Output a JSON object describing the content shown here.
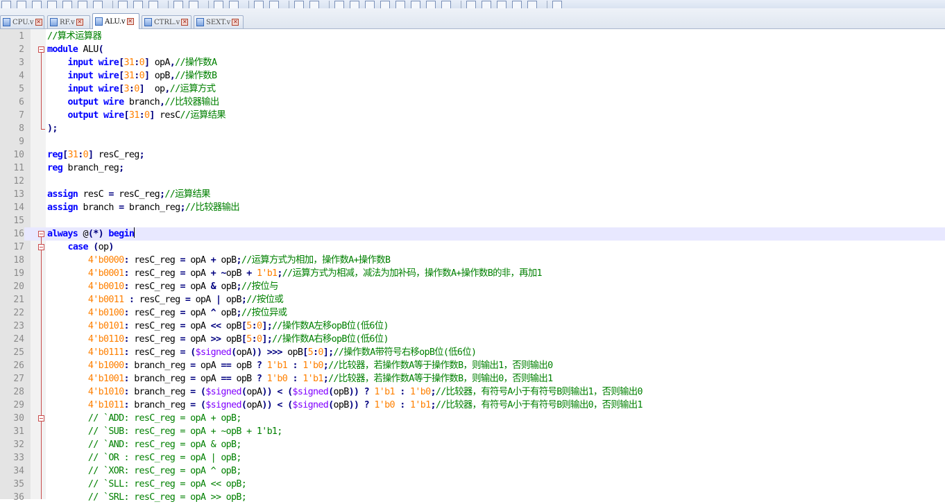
{
  "toolbar": {
    "icons": [
      "new-file-icon",
      "open-file-icon",
      "save-icon",
      "save-all-icon",
      "close-icon",
      "close-all-icon",
      "print-icon",
      "separator",
      "cut-icon",
      "copy-icon",
      "paste-icon",
      "separator",
      "undo-icon",
      "redo-icon",
      "separator",
      "find-icon",
      "replace-icon",
      "separator",
      "zoom-in-icon",
      "zoom-out-icon",
      "separator",
      "sync-v-icon",
      "sync-h-icon",
      "separator",
      "word-wrap-icon",
      "all-chars-icon",
      "indent-guide-icon",
      "user-lang-icon",
      "doc-map-icon",
      "function-list-icon",
      "folder-workspace-icon",
      "monitor-icon",
      "separator",
      "record-macro-icon",
      "stop-macro-icon",
      "play-macro-icon",
      "run-macro-icon",
      "save-macro-icon",
      "separator",
      "spellcheck-icon"
    ]
  },
  "tabs": [
    {
      "label": "CPU.v",
      "active": false
    },
    {
      "label": "RF.v",
      "active": false
    },
    {
      "label": "ALU.v",
      "active": true
    },
    {
      "label": "CTRL.v",
      "active": false
    },
    {
      "label": "SEXT.v",
      "active": false
    }
  ],
  "colors": {
    "comment": "#008000",
    "keyword": "#0000ff",
    "number": "#ff8000",
    "operator": "#000080",
    "system_task": "#8000ff",
    "current_line": "#e8e8ff"
  },
  "current_line": 16,
  "lines": [
    {
      "n": "1",
      "t": [
        [
          "cm",
          "//算术运算器"
        ]
      ]
    },
    {
      "n": "2",
      "t": [
        [
          "kw",
          "module"
        ],
        [
          "id",
          " ALU"
        ],
        [
          "op",
          "("
        ]
      ]
    },
    {
      "n": "3",
      "t": [
        [
          "id",
          "    "
        ],
        [
          "kw",
          "input"
        ],
        [
          "id",
          " "
        ],
        [
          "kw",
          "wire"
        ],
        [
          "op",
          "["
        ],
        [
          "num",
          "31"
        ],
        [
          "op",
          ":"
        ],
        [
          "num",
          "0"
        ],
        [
          "op",
          "]"
        ],
        [
          "id",
          " opA"
        ],
        [
          "op",
          ","
        ],
        [
          "cm",
          "//操作数A"
        ]
      ]
    },
    {
      "n": "4",
      "t": [
        [
          "id",
          "    "
        ],
        [
          "kw",
          "input"
        ],
        [
          "id",
          " "
        ],
        [
          "kw",
          "wire"
        ],
        [
          "op",
          "["
        ],
        [
          "num",
          "31"
        ],
        [
          "op",
          ":"
        ],
        [
          "num",
          "0"
        ],
        [
          "op",
          "]"
        ],
        [
          "id",
          " opB"
        ],
        [
          "op",
          ","
        ],
        [
          "cm",
          "//操作数B"
        ]
      ]
    },
    {
      "n": "5",
      "t": [
        [
          "id",
          "    "
        ],
        [
          "kw",
          "input"
        ],
        [
          "id",
          " "
        ],
        [
          "kw",
          "wire"
        ],
        [
          "op",
          "["
        ],
        [
          "num",
          "3"
        ],
        [
          "op",
          ":"
        ],
        [
          "num",
          "0"
        ],
        [
          "op",
          "]"
        ],
        [
          "id",
          "  op"
        ],
        [
          "op",
          ","
        ],
        [
          "cm",
          "//运算方式"
        ]
      ]
    },
    {
      "n": "6",
      "t": [
        [
          "id",
          "    "
        ],
        [
          "kw",
          "output"
        ],
        [
          "id",
          " "
        ],
        [
          "kw",
          "wire"
        ],
        [
          "id",
          " branch"
        ],
        [
          "op",
          ","
        ],
        [
          "cm",
          "//比较器输出"
        ]
      ]
    },
    {
      "n": "7",
      "t": [
        [
          "id",
          "    "
        ],
        [
          "kw",
          "output"
        ],
        [
          "id",
          " "
        ],
        [
          "kw",
          "wire"
        ],
        [
          "op",
          "["
        ],
        [
          "num",
          "31"
        ],
        [
          "op",
          ":"
        ],
        [
          "num",
          "0"
        ],
        [
          "op",
          "]"
        ],
        [
          "id",
          " resC"
        ],
        [
          "cm",
          "//运算结果"
        ]
      ]
    },
    {
      "n": "8",
      "t": [
        [
          "op",
          ")"
        ],
        [
          "op",
          ";"
        ]
      ]
    },
    {
      "n": "9",
      "t": []
    },
    {
      "n": "10",
      "t": [
        [
          "kw",
          "reg"
        ],
        [
          "op",
          "["
        ],
        [
          "num",
          "31"
        ],
        [
          "op",
          ":"
        ],
        [
          "num",
          "0"
        ],
        [
          "op",
          "]"
        ],
        [
          "id",
          " resC_reg"
        ],
        [
          "op",
          ";"
        ]
      ]
    },
    {
      "n": "11",
      "t": [
        [
          "kw",
          "reg"
        ],
        [
          "id",
          " branch_reg"
        ],
        [
          "op",
          ";"
        ]
      ]
    },
    {
      "n": "12",
      "t": []
    },
    {
      "n": "13",
      "t": [
        [
          "kw",
          "assign"
        ],
        [
          "id",
          " resC "
        ],
        [
          "op",
          "="
        ],
        [
          "id",
          " resC_reg"
        ],
        [
          "op",
          ";"
        ],
        [
          "cm",
          "//运算结果"
        ]
      ]
    },
    {
      "n": "14",
      "t": [
        [
          "kw",
          "assign"
        ],
        [
          "id",
          " branch "
        ],
        [
          "op",
          "="
        ],
        [
          "id",
          " branch_reg"
        ],
        [
          "op",
          ";"
        ],
        [
          "cm",
          "//比较器输出"
        ]
      ]
    },
    {
      "n": "15",
      "t": []
    },
    {
      "n": "16",
      "t": [
        [
          "kw",
          "always"
        ],
        [
          "id",
          " @"
        ],
        [
          "op",
          "(*)"
        ],
        [
          "id",
          " "
        ],
        [
          "kw",
          "begin"
        ]
      ]
    },
    {
      "n": "17",
      "t": [
        [
          "id",
          "    "
        ],
        [
          "kw",
          "case"
        ],
        [
          "id",
          " "
        ],
        [
          "op",
          "("
        ],
        [
          "id",
          "op"
        ],
        [
          "op",
          ")"
        ]
      ]
    },
    {
      "n": "18",
      "t": [
        [
          "id",
          "        "
        ],
        [
          "num",
          "4'b0000"
        ],
        [
          "op",
          ":"
        ],
        [
          "id",
          " resC_reg "
        ],
        [
          "op",
          "="
        ],
        [
          "id",
          " opA "
        ],
        [
          "op",
          "+"
        ],
        [
          "id",
          " opB"
        ],
        [
          "op",
          ";"
        ],
        [
          "cm",
          "//运算方式为相加，操作数A+操作数B"
        ]
      ]
    },
    {
      "n": "19",
      "t": [
        [
          "id",
          "        "
        ],
        [
          "num",
          "4'b0001"
        ],
        [
          "op",
          ":"
        ],
        [
          "id",
          " resC_reg "
        ],
        [
          "op",
          "="
        ],
        [
          "id",
          " opA "
        ],
        [
          "op",
          "+"
        ],
        [
          "id",
          " "
        ],
        [
          "op",
          "~"
        ],
        [
          "id",
          "opB "
        ],
        [
          "op",
          "+"
        ],
        [
          "id",
          " "
        ],
        [
          "num",
          "1'b1"
        ],
        [
          "op",
          ";"
        ],
        [
          "cm",
          "//运算方式为相减，减法为加补码，操作数A+操作数B的非，再加1"
        ]
      ]
    },
    {
      "n": "20",
      "t": [
        [
          "id",
          "        "
        ],
        [
          "num",
          "4'b0010"
        ],
        [
          "op",
          ":"
        ],
        [
          "id",
          " resC_reg "
        ],
        [
          "op",
          "="
        ],
        [
          "id",
          " opA "
        ],
        [
          "op",
          "&"
        ],
        [
          "id",
          " opB"
        ],
        [
          "op",
          ";"
        ],
        [
          "cm",
          "//按位与"
        ]
      ]
    },
    {
      "n": "21",
      "t": [
        [
          "id",
          "        "
        ],
        [
          "num",
          "4'b0011"
        ],
        [
          "id",
          " "
        ],
        [
          "op",
          ":"
        ],
        [
          "id",
          " resC_reg "
        ],
        [
          "op",
          "="
        ],
        [
          "id",
          " opA "
        ],
        [
          "op",
          "|"
        ],
        [
          "id",
          " opB"
        ],
        [
          "op",
          ";"
        ],
        [
          "cm",
          "//按位或"
        ]
      ]
    },
    {
      "n": "22",
      "t": [
        [
          "id",
          "        "
        ],
        [
          "num",
          "4'b0100"
        ],
        [
          "op",
          ":"
        ],
        [
          "id",
          " resC_reg "
        ],
        [
          "op",
          "="
        ],
        [
          "id",
          " opA "
        ],
        [
          "op",
          "^"
        ],
        [
          "id",
          " opB"
        ],
        [
          "op",
          ";"
        ],
        [
          "cm",
          "//按位异或"
        ]
      ]
    },
    {
      "n": "23",
      "t": [
        [
          "id",
          "        "
        ],
        [
          "num",
          "4'b0101"
        ],
        [
          "op",
          ":"
        ],
        [
          "id",
          " resC_reg "
        ],
        [
          "op",
          "="
        ],
        [
          "id",
          " opA "
        ],
        [
          "op",
          "<<"
        ],
        [
          "id",
          " opB"
        ],
        [
          "op",
          "["
        ],
        [
          "num",
          "5"
        ],
        [
          "op",
          ":"
        ],
        [
          "num",
          "0"
        ],
        [
          "op",
          "];"
        ],
        [
          "cm",
          "//操作数A左移opB位(低6位)"
        ]
      ]
    },
    {
      "n": "24",
      "t": [
        [
          "id",
          "        "
        ],
        [
          "num",
          "4'b0110"
        ],
        [
          "op",
          ":"
        ],
        [
          "id",
          " resC_reg "
        ],
        [
          "op",
          "="
        ],
        [
          "id",
          " opA "
        ],
        [
          "op",
          ">>"
        ],
        [
          "id",
          " opB"
        ],
        [
          "op",
          "["
        ],
        [
          "num",
          "5"
        ],
        [
          "op",
          ":"
        ],
        [
          "num",
          "0"
        ],
        [
          "op",
          "];"
        ],
        [
          "cm",
          "//操作数A右移opB位(低6位)"
        ]
      ]
    },
    {
      "n": "25",
      "t": [
        [
          "id",
          "        "
        ],
        [
          "num",
          "4'b0111"
        ],
        [
          "op",
          ":"
        ],
        [
          "id",
          " resC_reg "
        ],
        [
          "op",
          "="
        ],
        [
          "id",
          " "
        ],
        [
          "op",
          "("
        ],
        [
          "sys",
          "$signed"
        ],
        [
          "op",
          "("
        ],
        [
          "id",
          "opA"
        ],
        [
          "op",
          "))"
        ],
        [
          "id",
          " "
        ],
        [
          "op",
          ">>>"
        ],
        [
          "id",
          " opB"
        ],
        [
          "op",
          "["
        ],
        [
          "num",
          "5"
        ],
        [
          "op",
          ":"
        ],
        [
          "num",
          "0"
        ],
        [
          "op",
          "];"
        ],
        [
          "cm",
          "//操作数A带符号右移opB位(低6位)"
        ]
      ]
    },
    {
      "n": "26",
      "t": [
        [
          "id",
          "        "
        ],
        [
          "num",
          "4'b1000"
        ],
        [
          "op",
          ":"
        ],
        [
          "id",
          " branch_reg "
        ],
        [
          "op",
          "="
        ],
        [
          "id",
          " opA "
        ],
        [
          "op",
          "=="
        ],
        [
          "id",
          " opB "
        ],
        [
          "op",
          "?"
        ],
        [
          "id",
          " "
        ],
        [
          "num",
          "1'b1"
        ],
        [
          "id",
          " "
        ],
        [
          "op",
          ":"
        ],
        [
          "id",
          " "
        ],
        [
          "num",
          "1'b0"
        ],
        [
          "op",
          ";"
        ],
        [
          "cm",
          "//比较器，若操作数A等于操作数B，则输出1，否则输出0"
        ]
      ]
    },
    {
      "n": "27",
      "t": [
        [
          "id",
          "        "
        ],
        [
          "num",
          "4'b1001"
        ],
        [
          "op",
          ":"
        ],
        [
          "id",
          " branch_reg "
        ],
        [
          "op",
          "="
        ],
        [
          "id",
          " opA "
        ],
        [
          "op",
          "=="
        ],
        [
          "id",
          " opB "
        ],
        [
          "op",
          "?"
        ],
        [
          "id",
          " "
        ],
        [
          "num",
          "1'b0"
        ],
        [
          "id",
          " "
        ],
        [
          "op",
          ":"
        ],
        [
          "id",
          " "
        ],
        [
          "num",
          "1'b1"
        ],
        [
          "op",
          ";"
        ],
        [
          "cm",
          "//比较器，若操作数A等于操作数B，则输出0，否则输出1"
        ]
      ]
    },
    {
      "n": "28",
      "t": [
        [
          "id",
          "        "
        ],
        [
          "num",
          "4'b1010"
        ],
        [
          "op",
          ":"
        ],
        [
          "id",
          " branch_reg "
        ],
        [
          "op",
          "="
        ],
        [
          "id",
          " "
        ],
        [
          "op",
          "("
        ],
        [
          "sys",
          "$signed"
        ],
        [
          "op",
          "("
        ],
        [
          "id",
          "opA"
        ],
        [
          "op",
          "))"
        ],
        [
          "id",
          " "
        ],
        [
          "op",
          "<"
        ],
        [
          "id",
          " "
        ],
        [
          "op",
          "("
        ],
        [
          "sys",
          "$signed"
        ],
        [
          "op",
          "("
        ],
        [
          "id",
          "opB"
        ],
        [
          "op",
          "))"
        ],
        [
          "id",
          " "
        ],
        [
          "op",
          "?"
        ],
        [
          "id",
          " "
        ],
        [
          "num",
          "1'b1"
        ],
        [
          "id",
          " "
        ],
        [
          "op",
          ":"
        ],
        [
          "id",
          " "
        ],
        [
          "num",
          "1'b0"
        ],
        [
          "op",
          ";"
        ],
        [
          "cm",
          "//比较器，有符号A小于有符号B则输出1，否则输出0"
        ]
      ]
    },
    {
      "n": "29",
      "t": [
        [
          "id",
          "        "
        ],
        [
          "num",
          "4'b1011"
        ],
        [
          "op",
          ":"
        ],
        [
          "id",
          " branch_reg "
        ],
        [
          "op",
          "="
        ],
        [
          "id",
          " "
        ],
        [
          "op",
          "("
        ],
        [
          "sys",
          "$signed"
        ],
        [
          "op",
          "("
        ],
        [
          "id",
          "opA"
        ],
        [
          "op",
          "))"
        ],
        [
          "id",
          " "
        ],
        [
          "op",
          "<"
        ],
        [
          "id",
          " "
        ],
        [
          "op",
          "("
        ],
        [
          "sys",
          "$signed"
        ],
        [
          "op",
          "("
        ],
        [
          "id",
          "opB"
        ],
        [
          "op",
          "))"
        ],
        [
          "id",
          " "
        ],
        [
          "op",
          "?"
        ],
        [
          "id",
          " "
        ],
        [
          "num",
          "1'b0"
        ],
        [
          "id",
          " "
        ],
        [
          "op",
          ":"
        ],
        [
          "id",
          " "
        ],
        [
          "num",
          "1'b1"
        ],
        [
          "op",
          ";"
        ],
        [
          "cm",
          "//比较器，有符号A小于有符号B则输出0，否则输出1"
        ]
      ]
    },
    {
      "n": "30",
      "t": [
        [
          "id",
          "        "
        ],
        [
          "cm",
          "// `ADD: resC_reg = opA + opB;"
        ]
      ]
    },
    {
      "n": "31",
      "t": [
        [
          "id",
          "        "
        ],
        [
          "cm",
          "// `SUB: resC_reg = opA + ~opB + 1'b1;"
        ]
      ]
    },
    {
      "n": "32",
      "t": [
        [
          "id",
          "        "
        ],
        [
          "cm",
          "// `AND: resC_reg = opA & opB;"
        ]
      ]
    },
    {
      "n": "33",
      "t": [
        [
          "id",
          "        "
        ],
        [
          "cm",
          "// `OR : resC_reg = opA | opB;"
        ]
      ]
    },
    {
      "n": "34",
      "t": [
        [
          "id",
          "        "
        ],
        [
          "cm",
          "// `XOR: resC_reg = opA ^ opB;"
        ]
      ]
    },
    {
      "n": "35",
      "t": [
        [
          "id",
          "        "
        ],
        [
          "cm",
          "// `SLL: resC_reg = opA << opB;"
        ]
      ]
    },
    {
      "n": "36",
      "t": [
        [
          "id",
          "        "
        ],
        [
          "cm",
          "// `SRL: resC_reg = opA >> opB;"
        ]
      ]
    }
  ]
}
